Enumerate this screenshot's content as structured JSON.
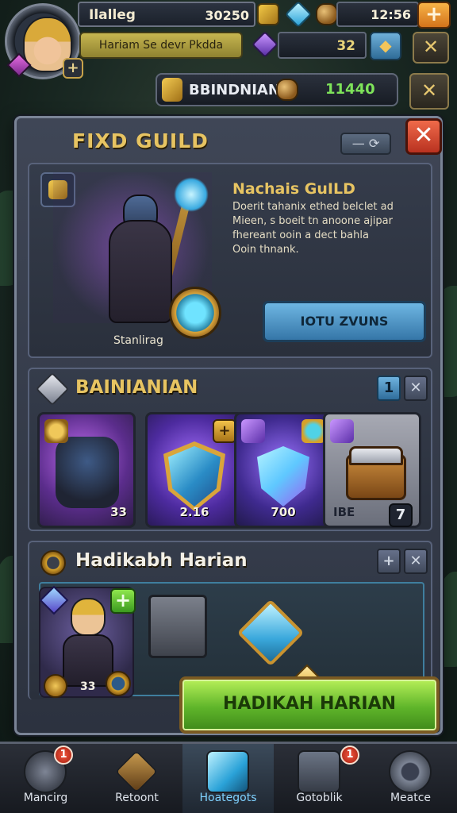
{
  "player": {
    "name": "Ilalleg",
    "power": "30250",
    "title": "Hariam Se devr Pkdda"
  },
  "resources": {
    "time": "12:56",
    "purple_value": "32",
    "guild_name": "BBINDNIAN",
    "guild_value": "11440"
  },
  "panel": {
    "title": "FIXD GUILD",
    "toggle_label": "— ⟳",
    "close_symbol": "✕",
    "hero_caption": "Stanlirag",
    "desc_title": "Nachais GuILD",
    "desc_lines": [
      "Doerit tahanix ethed belclet ad",
      "Mieen, s boeit tn anoone ajipar",
      "fhereant ooin a dect bahla",
      "Ooin thnank."
    ],
    "cta_label": "IOTU ZVUNS"
  },
  "rewards": {
    "title": "BAINIANIAN",
    "mini_left": "1",
    "mini_right": "✕",
    "cards": [
      {
        "label": "33",
        "corner": ""
      },
      {
        "label": "2.16",
        "corner": "+"
      },
      {
        "label": "700",
        "corner": ""
      },
      {
        "label": "IBE",
        "corner": "7"
      }
    ]
  },
  "daily": {
    "title": "Hadikabh Harian",
    "mini_left": "+",
    "mini_right": "✕",
    "hero_count": "33",
    "plus_symbol": "+",
    "claim_label": "HADIKAH HARIAN"
  },
  "nav": [
    {
      "label": "Mancirg",
      "badge": "1"
    },
    {
      "label": "Retoont",
      "badge": ""
    },
    {
      "label": "Hoategots",
      "badge": ""
    },
    {
      "label": "Gotoblik",
      "badge": "1"
    },
    {
      "label": "Meatce",
      "badge": ""
    }
  ],
  "colors": {
    "accent_gold": "#e7c462",
    "claim_green": "#5fb52a",
    "close_red": "#d8452e",
    "cta_blue": "#4f93c6"
  },
  "icons": [
    "avatar-portrait",
    "pink-gem-icon",
    "plus-icon",
    "gold-cube-icon",
    "blue-gem-icon",
    "ore-icon",
    "purple-gem-icon",
    "shield-icon",
    "chest-icon",
    "crystal-icon",
    "stone-block-icon",
    "sword-icon",
    "gear-icon"
  ]
}
